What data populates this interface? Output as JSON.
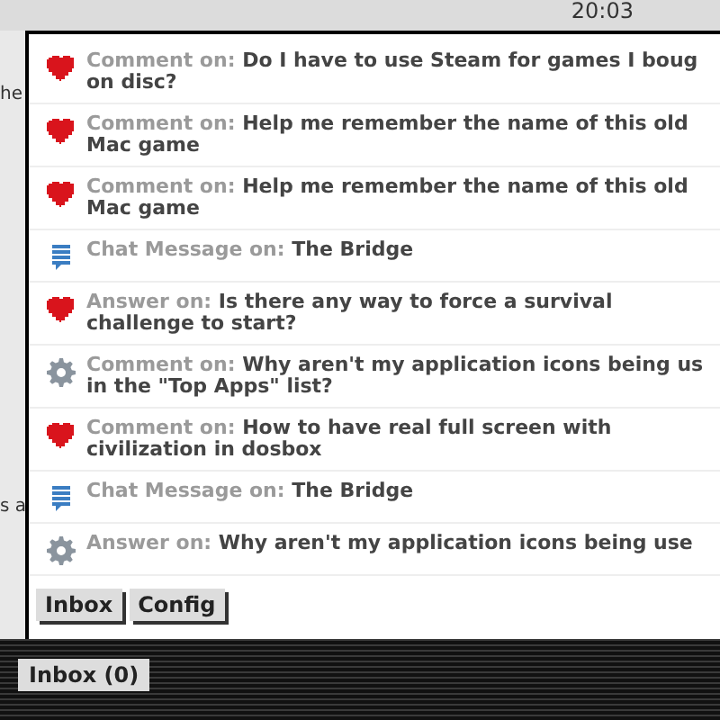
{
  "clock": "20:03",
  "background_fragments": [
    "he",
    "s a"
  ],
  "notifications": [
    {
      "kind": "heart",
      "prefix": "Comment on:",
      "lines": [
        "Do I have to use Steam for games I boug",
        "on disc?"
      ]
    },
    {
      "kind": "heart",
      "prefix": "Comment on:",
      "lines": [
        "Help me remember the name of this old",
        "Mac game"
      ]
    },
    {
      "kind": "heart",
      "prefix": "Comment on:",
      "lines": [
        "Help me remember the name of this old",
        "Mac game"
      ]
    },
    {
      "kind": "chat",
      "prefix": "Chat Message on:",
      "lines": [
        "The Bridge"
      ]
    },
    {
      "kind": "heart",
      "prefix": "Answer on:",
      "lines": [
        "Is there any way to force a survival",
        "challenge to start?"
      ]
    },
    {
      "kind": "gear",
      "prefix": "Comment on:",
      "lines": [
        "Why aren't my application icons being us",
        "in the \"Top Apps\" list?"
      ]
    },
    {
      "kind": "heart",
      "prefix": "Comment on:",
      "lines": [
        "How to have real full screen with",
        "civilization in dosbox"
      ]
    },
    {
      "kind": "chat",
      "prefix": "Chat Message on:",
      "lines": [
        "The Bridge"
      ]
    },
    {
      "kind": "gear",
      "prefix": "Answer on:",
      "lines": [
        "Why aren't my application icons being use"
      ]
    }
  ],
  "popup_buttons": [
    "Inbox",
    "Config"
  ],
  "taskbar_button": "Inbox (0)"
}
